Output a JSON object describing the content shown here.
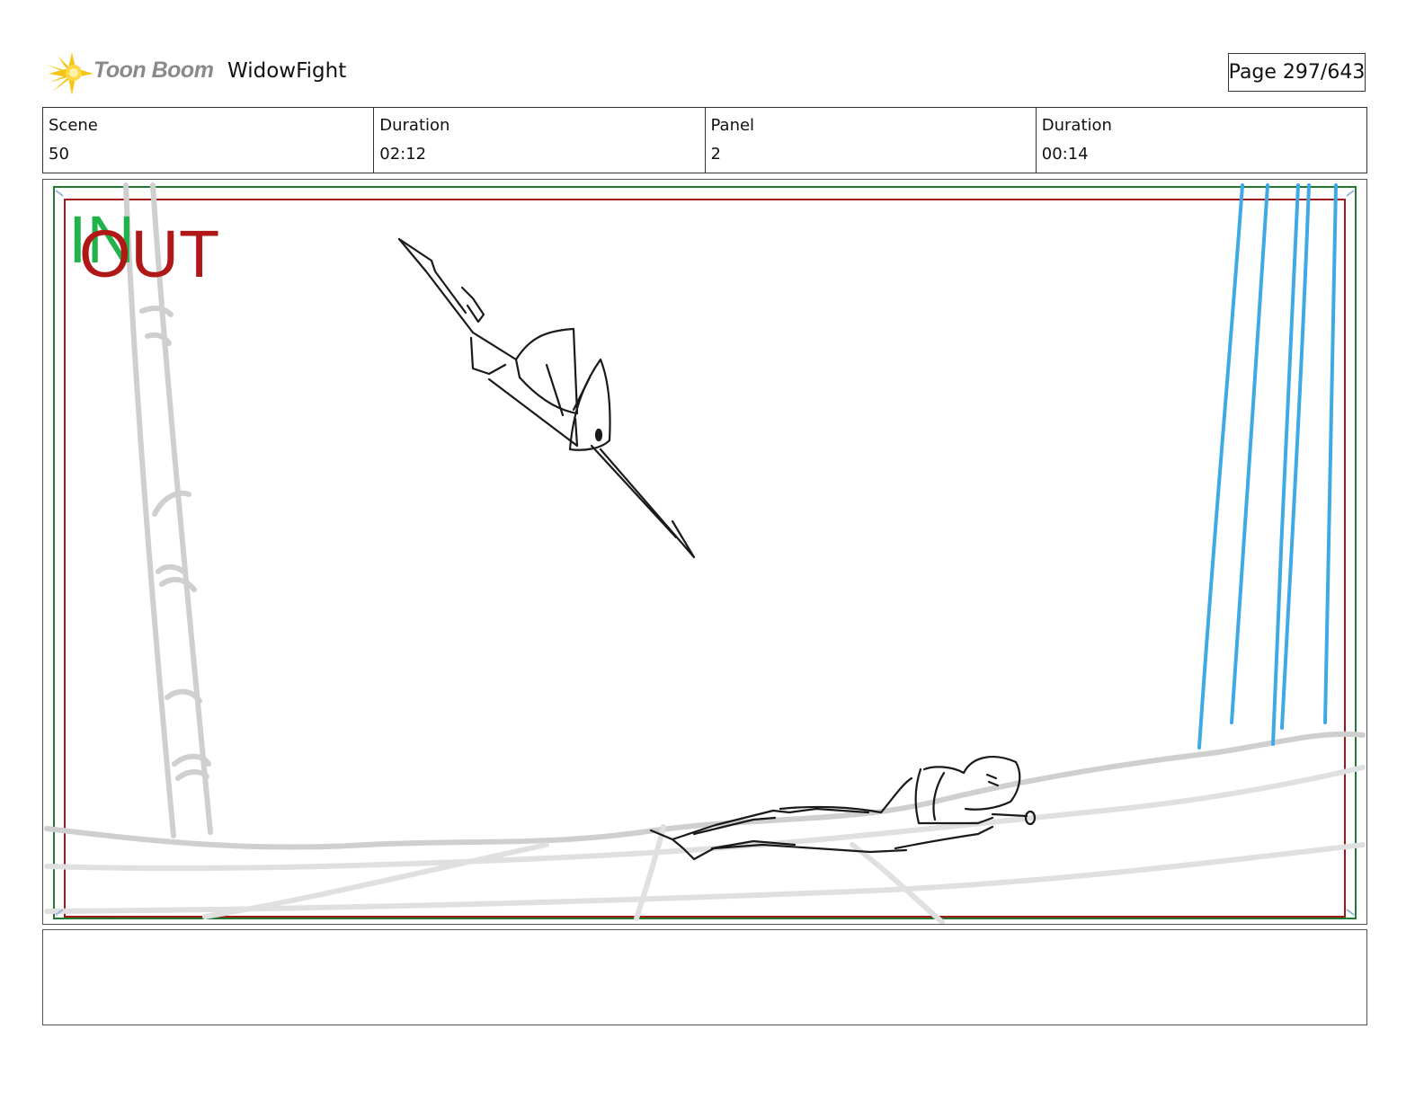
{
  "header": {
    "brand_name": "Toon Boom",
    "project_title": "WidowFight",
    "page_indicator": "Page 297/643"
  },
  "info": {
    "scene_label": "Scene",
    "scene_value": "50",
    "scene_duration_label": "Duration",
    "scene_duration_value": "02:12",
    "panel_label": "Panel",
    "panel_value": "2",
    "panel_duration_label": "Duration",
    "panel_duration_value": "00:14"
  },
  "frame": {
    "in_label": "IN",
    "out_label": "OUT",
    "in_color": "#22b24c",
    "out_color": "#b01818"
  },
  "notes": {
    "text": ""
  }
}
